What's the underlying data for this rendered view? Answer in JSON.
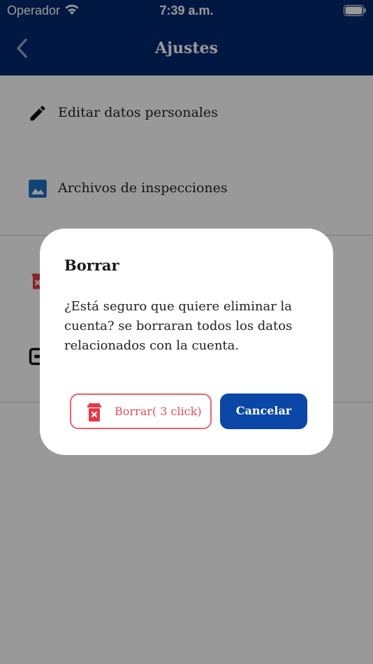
{
  "status_bar": {
    "carrier": "Operador",
    "time": "7:39 a.m."
  },
  "nav": {
    "title": "Ajustes",
    "back_icon": "chevron-left-icon"
  },
  "settings": {
    "items": [
      {
        "label": "Editar datos personales",
        "icon": "pencil-icon"
      },
      {
        "label": "Archivos de inspecciones",
        "icon": "image-icon"
      },
      {
        "label": "",
        "icon": "trash-icon"
      },
      {
        "label": "",
        "icon": "logout-icon"
      }
    ]
  },
  "dialog": {
    "title": "Borrar",
    "message": "¿Está seguro que quiere eliminar la cuenta? se borraran todos los datos relacionados con la cuenta.",
    "delete_label": "Borrar( 3 click)",
    "cancel_label": "Cancelar"
  },
  "colors": {
    "header": "#03296f",
    "primary": "#0a47a7",
    "danger": "#e8636b",
    "icon_blue": "#1f6fc5"
  }
}
